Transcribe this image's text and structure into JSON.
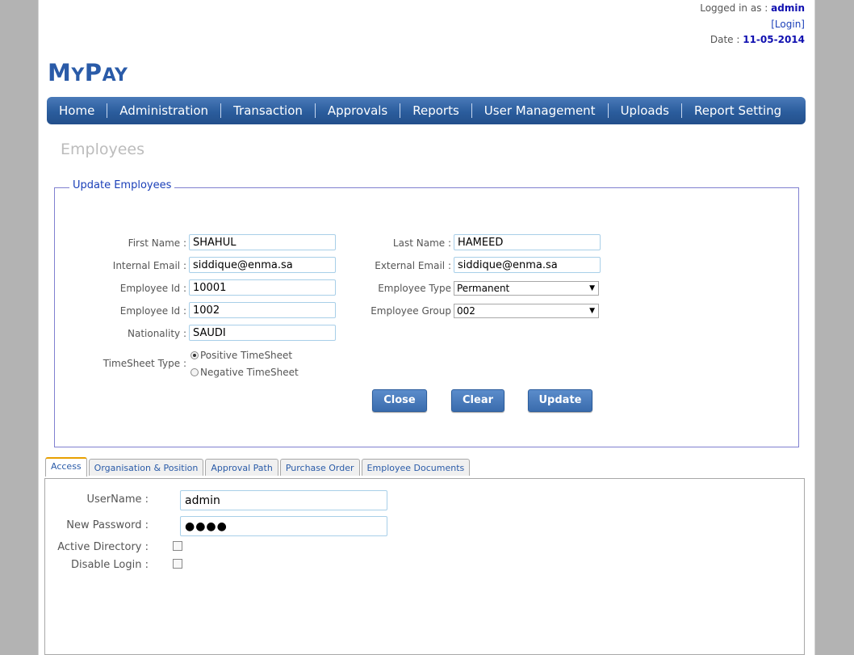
{
  "header": {
    "logged_in_label": "Logged in as :",
    "username": "admin",
    "login_link": "[Login]",
    "date_label": "Date :",
    "date_value": "11-05-2014",
    "logo": "MyPay"
  },
  "nav": {
    "items": [
      "Home",
      "Administration",
      "Transaction",
      "Approvals",
      "Reports",
      "User Management",
      "Uploads",
      "Report Setting"
    ]
  },
  "page": {
    "title": "Employees"
  },
  "form": {
    "legend": "Update Employees",
    "first_name_label": "First Name :",
    "first_name": "SHAHUL",
    "last_name_label": "Last Name :",
    "last_name": "HAMEED",
    "internal_email_label": "Internal Email :",
    "internal_email": "siddique@enma.sa",
    "external_email_label": "External Email :",
    "external_email": "siddique@enma.sa",
    "employee_id_label": "Employee Id :",
    "employee_id": "10001",
    "employee_type_label": "Employee Type",
    "employee_type": "Permanent",
    "employee_id2_label": "Employee Id :",
    "employee_id2": "1002",
    "employee_group_label": "Employee Group",
    "employee_group": "002",
    "nationality_label": "Nationality :",
    "nationality": "SAUDI",
    "timesheet_label": "TimeSheet Type :",
    "timesheet_positive": "Positive TimeSheet",
    "timesheet_negative": "Negative TimeSheet",
    "timesheet_selected": "positive",
    "close_label": "Close",
    "clear_label": "Clear",
    "update_label": "Update"
  },
  "tabs": {
    "items": [
      "Access",
      "Organisation & Position",
      "Approval Path",
      "Purchase Order",
      "Employee Documents"
    ],
    "active": "Access"
  },
  "access": {
    "username_label": "UserName :",
    "username": "admin",
    "password_label": "New Password :",
    "password": "●●●●",
    "active_directory_label": "Active Directory :",
    "active_directory_checked": false,
    "disable_login_label": "Disable Login :",
    "disable_login_checked": false
  },
  "colors": {
    "nav_blue": "#2b5d9d",
    "logo_blue": "#2a5ba8",
    "highlight_blue": "#1010b0",
    "tab_active_accent": "#e8a000"
  }
}
